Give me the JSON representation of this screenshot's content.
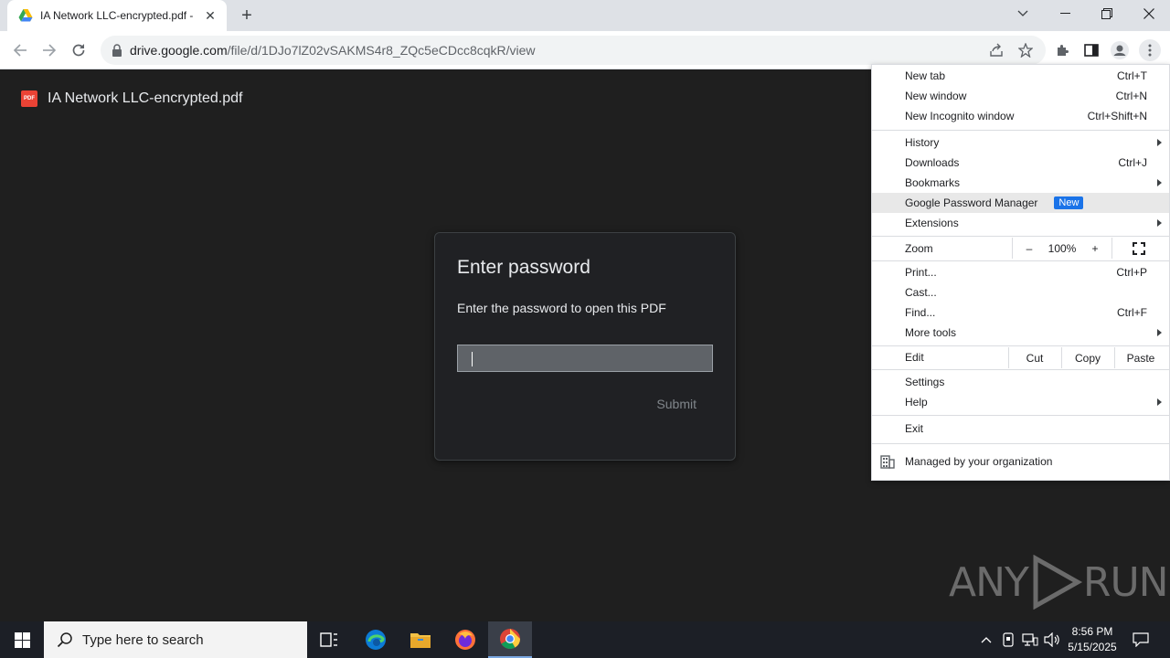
{
  "browser": {
    "tab_title": "IA Network LLC-encrypted.pdf - ",
    "url_host": "drive.google.com",
    "url_path": "/file/d/1DJo7lZ02vSAKMS4r8_ZQc5eCDcc8cqkR/view"
  },
  "viewer": {
    "file_title": "IA Network LLC-encrypted.pdf",
    "file_badge": "PDF"
  },
  "dialog": {
    "title": "Enter password",
    "message": "Enter the password to open this PDF",
    "password_value": "",
    "submit_label": "Submit"
  },
  "menu": {
    "new_tab": {
      "label": "New tab",
      "shortcut": "Ctrl+T"
    },
    "new_window": {
      "label": "New window",
      "shortcut": "Ctrl+N"
    },
    "new_incognito": {
      "label": "New Incognito window",
      "shortcut": "Ctrl+Shift+N"
    },
    "history": {
      "label": "History"
    },
    "downloads": {
      "label": "Downloads",
      "shortcut": "Ctrl+J"
    },
    "bookmarks": {
      "label": "Bookmarks"
    },
    "password_manager": {
      "label": "Google Password Manager",
      "badge": "New"
    },
    "extensions": {
      "label": "Extensions"
    },
    "zoom": {
      "label": "Zoom",
      "minus": "–",
      "level": "100%",
      "plus": "+"
    },
    "print": {
      "label": "Print...",
      "shortcut": "Ctrl+P"
    },
    "cast": {
      "label": "Cast..."
    },
    "find": {
      "label": "Find...",
      "shortcut": "Ctrl+F"
    },
    "more_tools": {
      "label": "More tools"
    },
    "edit": {
      "label": "Edit",
      "cut": "Cut",
      "copy": "Copy",
      "paste": "Paste"
    },
    "settings": {
      "label": "Settings"
    },
    "help": {
      "label": "Help"
    },
    "exit": {
      "label": "Exit"
    },
    "managed": {
      "label": "Managed by your organization"
    }
  },
  "watermark": {
    "left": "ANY",
    "right": "RUN"
  },
  "taskbar": {
    "search_placeholder": "Type here to search",
    "time": "8:56 PM",
    "date": "5/15/2025"
  },
  "colors": {
    "accent": "#1a73e8",
    "viewer_bg": "#1f1f1f",
    "pdf_red": "#ea4335"
  }
}
